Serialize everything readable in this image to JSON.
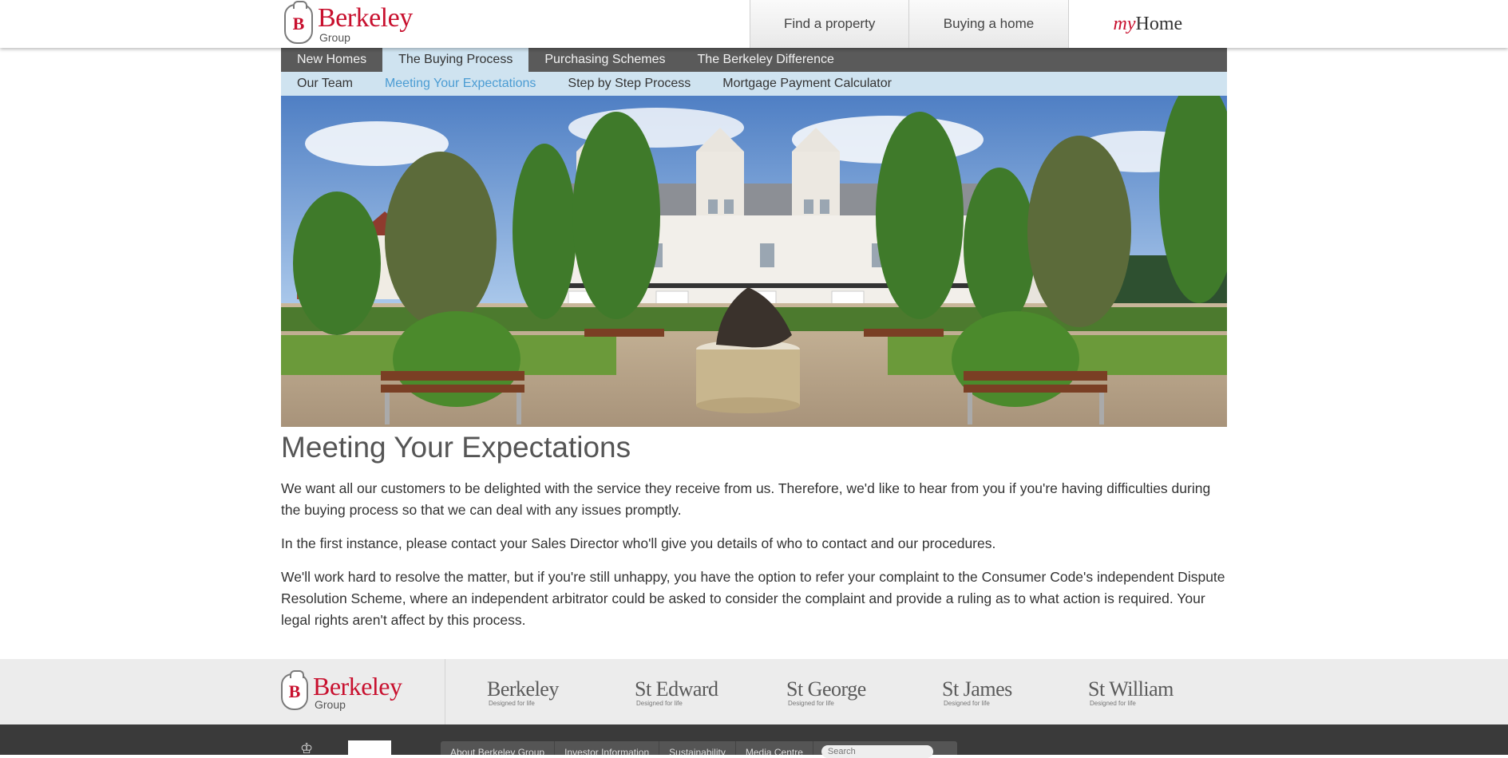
{
  "header": {
    "logo": {
      "mark": "B",
      "name": "Berkeley",
      "sub": "Group"
    },
    "top_links": [
      {
        "label": "Find a property"
      },
      {
        "label": "Buying a home"
      }
    ],
    "myhome": {
      "my": "my",
      "home": "Home"
    }
  },
  "nav_primary": {
    "items": [
      {
        "label": "New Homes"
      },
      {
        "label": "The Buying Process"
      },
      {
        "label": "Purchasing Schemes"
      },
      {
        "label": "The Berkeley Difference"
      }
    ],
    "active": "The Buying Process"
  },
  "nav_secondary": {
    "items": [
      {
        "label": "Our Team"
      },
      {
        "label": "Meeting Your Expectations"
      },
      {
        "label": "Step by Step Process"
      },
      {
        "label": "Mortgage Payment Calculator"
      }
    ],
    "active": "Meeting Your Expectations"
  },
  "hero": {
    "icon": "courtyard-photo"
  },
  "content": {
    "title": "Meeting Your Expectations",
    "paragraphs": [
      "We want all our customers to be delighted with the service they receive from us. Therefore, we'd like to hear from you if you're having difficulties during the buying process so that we can deal with any issues promptly.",
      "In the first instance, please contact your Sales Director who'll give you details of who to contact and our procedures.",
      "We'll work hard to resolve the matter, but if you're still unhappy, you have the option to refer your complaint to the Consumer Code's independent Dispute Resolution Scheme, where an independent arbitrator could be asked to consider the complaint and provide a ruling as to what action is required. Your legal rights aren't affect by this process."
    ]
  },
  "brands": {
    "group_logo": {
      "mark": "B",
      "name": "Berkeley",
      "sub": "Group"
    },
    "items": [
      {
        "name": "Berkeley",
        "tag": "Designed for life"
      },
      {
        "name": "St Edward",
        "tag": "Designed for life"
      },
      {
        "name": "St George",
        "tag": "Designed for life"
      },
      {
        "name": "St James",
        "tag": "Designed for life"
      },
      {
        "name": "St William",
        "tag": "Designed for life"
      }
    ]
  },
  "footer": {
    "links": [
      {
        "label": "About Berkeley Group"
      },
      {
        "label": "Investor Information"
      },
      {
        "label": "Sustainability"
      },
      {
        "label": "Media Centre"
      }
    ],
    "search_placeholder": "Search"
  },
  "colors": {
    "brand_red": "#c8102e",
    "nav_dark": "#5a5a5a",
    "nav_light": "#cfe3f0",
    "active_link": "#4b9cd3",
    "footer": "#3a3a3a"
  }
}
